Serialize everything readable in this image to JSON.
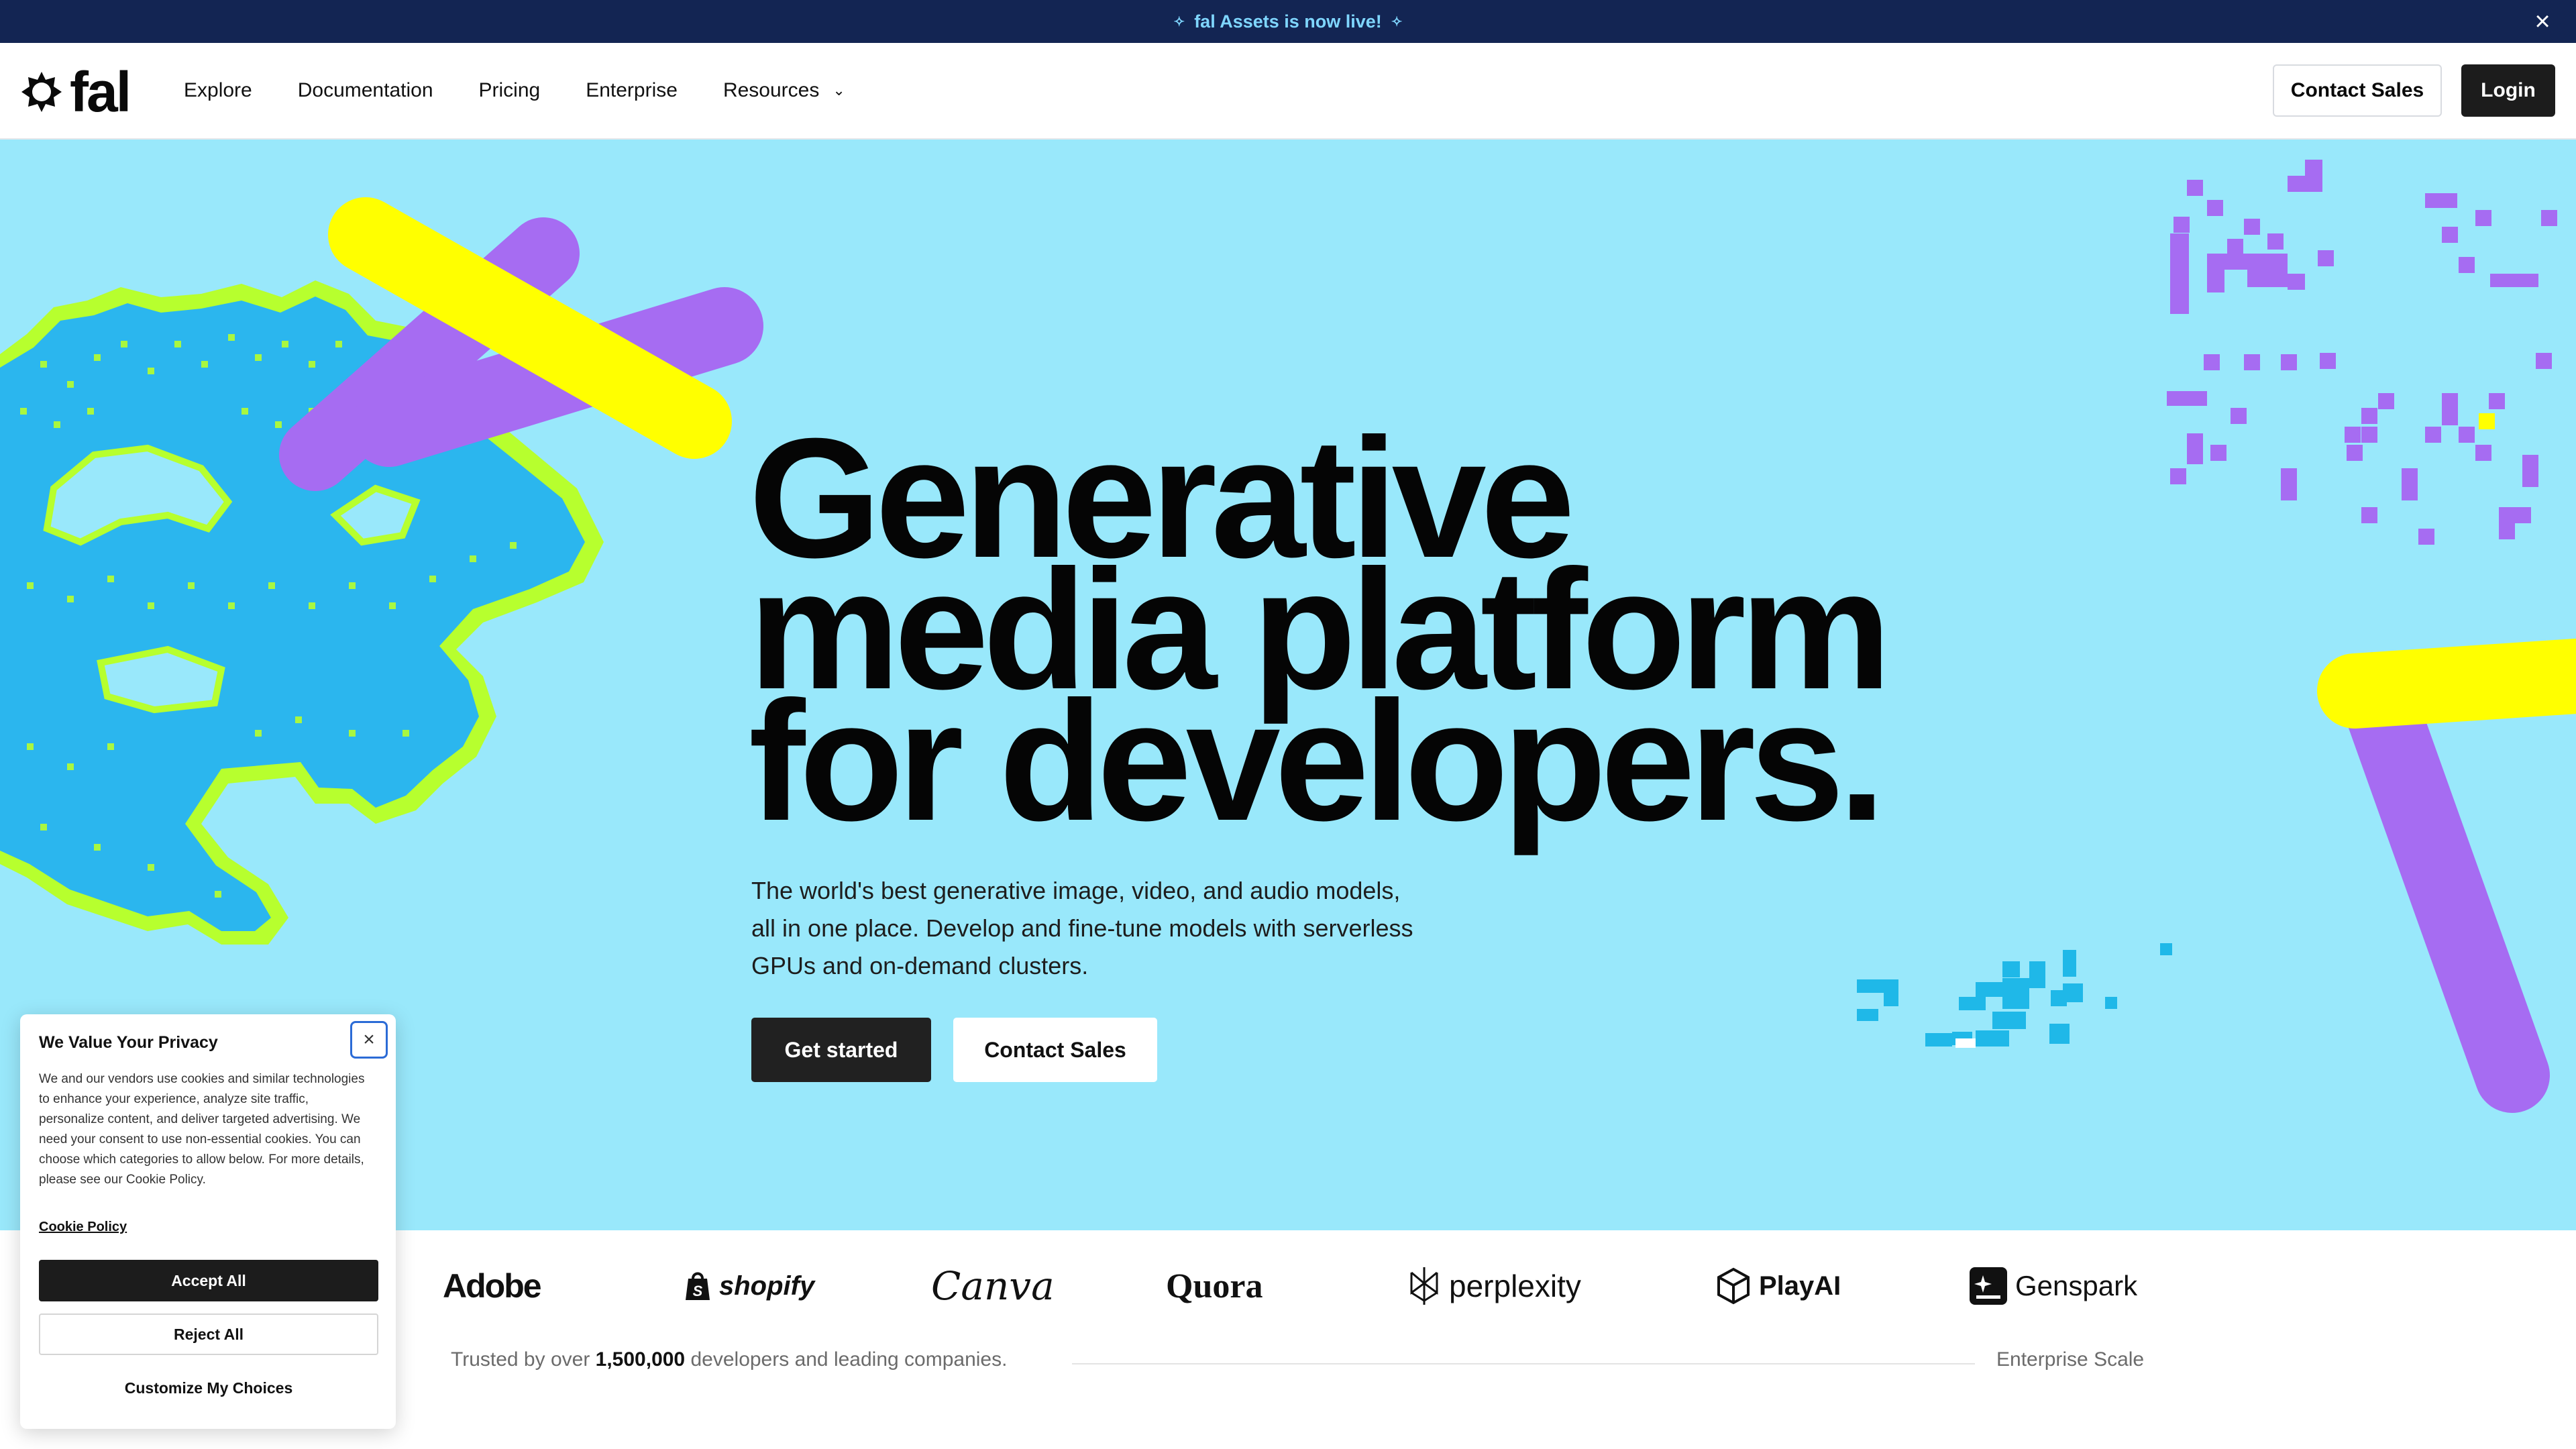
{
  "announcement": {
    "text": "fal Assets is now live!",
    "close_icon": "close-icon"
  },
  "nav": {
    "logo_text": "fal",
    "links": [
      "Explore",
      "Documentation",
      "Pricing",
      "Enterprise",
      "Resources"
    ],
    "contact_sales": "Contact Sales",
    "login": "Login"
  },
  "hero": {
    "headline": [
      "Generative",
      "media platform",
      "for developers."
    ],
    "subtitle": "The world's best generative image, video, and audio models, all in one place. Develop and fine-tune models with serverless GPUs and on-demand clusters.",
    "primary_cta": "Get started",
    "secondary_cta": "Contact Sales"
  },
  "logos": {
    "brands": [
      "Adobe",
      "shopify",
      "Canva",
      "Quora",
      "perplexity",
      "PlayAI",
      "Genspark"
    ],
    "trusted_prefix": "Trusted by over",
    "trusted_count": "1,500,000",
    "trusted_suffix": "developers and leading companies.",
    "enterprise_label": "Enterprise Scale"
  },
  "cookie": {
    "title": "We Value Your Privacy",
    "body": "We and our vendors use cookies and similar technologies to enhance your experience, analyze site traffic, personalize content, and deliver targeted advertising. We need your consent to use non-essential cookies. You can choose which categories to allow below. For more details, please see our Cookie Policy.",
    "policy_link": "Cookie Policy",
    "accept": "Accept All",
    "reject": "Reject All",
    "customize": "Customize My Choices"
  },
  "colors": {
    "hero_bg": "#99e8fb",
    "announcement_bg": "#132553",
    "accent_yellow": "#ffff00",
    "accent_purple": "#a66cf2",
    "accent_lime": "#b7ff2e",
    "accent_blue": "#2bb6ee"
  }
}
